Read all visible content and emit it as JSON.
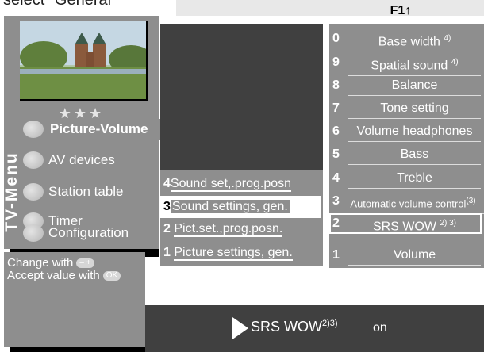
{
  "header": {
    "title": "select \"General\""
  },
  "function_key": {
    "label": "F1",
    "arrow": "↑"
  },
  "left_menu": {
    "side_label": "TV-Menu",
    "stars": "★★★",
    "items": [
      {
        "label": "Picture-Volume",
        "selected": true
      },
      {
        "label": "AV devices"
      },
      {
        "label": "Station table"
      },
      {
        "label": "Timer"
      },
      {
        "label": "Configuration"
      }
    ]
  },
  "middle_menu": {
    "items": [
      {
        "num": "4",
        "label": "Sound set,.prog.posn"
      },
      {
        "num": "3",
        "label": "Sound settings, gen.",
        "selected": true
      },
      {
        "num": "2",
        "label": "Pict.set.,prog.posn."
      },
      {
        "num": "1",
        "label": "Picture settings, gen."
      }
    ]
  },
  "right_menu": {
    "items": [
      {
        "num": "0",
        "label": "Base width",
        "sup": "4)"
      },
      {
        "num": "9",
        "label": "Spatial sound",
        "sup": "4)"
      },
      {
        "num": "8",
        "label": "Balance",
        "sup": ""
      },
      {
        "num": "7",
        "label": "Tone setting",
        "sup": ""
      },
      {
        "num": "6",
        "label": "Volume headphones",
        "sup": ""
      },
      {
        "num": "5",
        "label": "Bass",
        "sup": ""
      },
      {
        "num": "4",
        "label": "Treble",
        "sup": ""
      },
      {
        "num": "3",
        "label": "Automatic volume control",
        "sup": "(3)"
      },
      {
        "num": "2",
        "label": "SRS WOW",
        "sup": "2) 3)",
        "selected": true
      },
      {
        "num": "1",
        "label": "Volume",
        "sup": ""
      }
    ]
  },
  "help": {
    "line1": "Change with",
    "line1_key": "– +",
    "line2": "Accept value with",
    "line2_key": "OK"
  },
  "status": {
    "label": "SRS WOW",
    "sup": "2)3)",
    "value": "on"
  },
  "colors": {
    "panel_gray": "#8e8e8e",
    "dark_gray": "#404040",
    "highlight": "#ffffff"
  }
}
